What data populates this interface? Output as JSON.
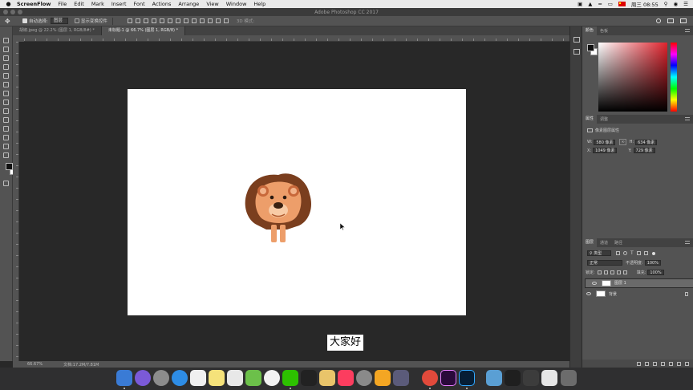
{
  "menubar": {
    "app": "ScreenFlow",
    "items": [
      "File",
      "Edit",
      "Mark",
      "Insert",
      "Font",
      "Actions",
      "Arrange",
      "View",
      "Window",
      "Help"
    ],
    "clock": "周三 08:55"
  },
  "window": {
    "title": "Adobe Photoshop CC 2017"
  },
  "options": {
    "auto_select_label": "自动选择:",
    "auto_select_value": "图层",
    "transform_label": "显示变换控件",
    "mode_label": "3D 模式:"
  },
  "tabs": [
    {
      "label": "胡椒.jpeg @ 22.2% (图层 1, RGB/8#) *",
      "active": false
    },
    {
      "label": "未标题-1 @ 66.7% (图层 1, RGB/8) *",
      "active": true
    }
  ],
  "status": {
    "zoom": "66.67%",
    "doc": "文档:17.2M/7.81M"
  },
  "subtitle": "大家好",
  "panels": {
    "color_tabs": [
      "颜色",
      "色板"
    ],
    "props_tabs": [
      "属性",
      "调整"
    ],
    "props_title": "像素图层属性",
    "w_label": "W:",
    "w_value": "580 像素",
    "h_label": "H:",
    "h_value": "634 像素",
    "x_label": "X:",
    "x_value": "1049 像素",
    "y_label": "Y:",
    "y_value": "729 像素",
    "layers_tabs": [
      "图层",
      "通道",
      "路径"
    ],
    "kind_label": "类型",
    "blend_mode": "正常",
    "opacity_label": "不透明度:",
    "opacity_value": "100%",
    "lock_label": "锁定:",
    "fill_label": "填充:",
    "fill_value": "100%",
    "layers": [
      {
        "name": "图层 1",
        "selected": true
      },
      {
        "name": "背景",
        "selected": false
      }
    ]
  },
  "colors": {
    "accent": "#e0232d",
    "workspace": "#282828",
    "panel": "#535353"
  }
}
